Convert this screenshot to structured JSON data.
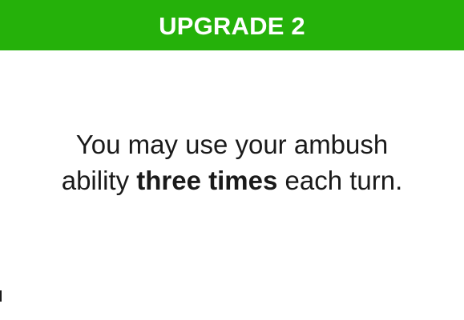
{
  "card": {
    "title": "UPGRADE 2",
    "body": {
      "line1": "You may use your ambush",
      "line2_before": "ability ",
      "line2_emphasis": "three times",
      "line2_after": " each turn."
    }
  },
  "colors": {
    "header_background": "#25b10a",
    "header_text": "#ffffff",
    "body_text": "#1a1a1a",
    "card_background": "#ffffff"
  }
}
